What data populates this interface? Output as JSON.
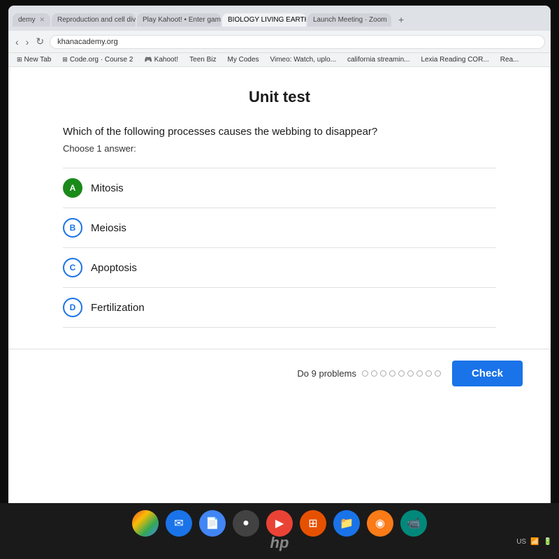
{
  "browser": {
    "address": "khanacademy.org",
    "tabs": [
      {
        "id": "t1",
        "label": "demy",
        "active": false
      },
      {
        "id": "t2",
        "label": "Reproduction and cell divi...",
        "active": false
      },
      {
        "id": "t3",
        "label": "Play Kahoot! • Enter game F",
        "active": false
      },
      {
        "id": "t4",
        "label": "BIOLOGY LIVING EARTH B T",
        "active": true
      },
      {
        "id": "t5",
        "label": "Launch Meeting · Zoom",
        "active": false
      }
    ]
  },
  "bookmarks": [
    {
      "id": "b1",
      "label": "New Tab"
    },
    {
      "id": "b2",
      "label": "Code.org · Course 2"
    },
    {
      "id": "b3",
      "label": "Kahoot!"
    },
    {
      "id": "b4",
      "label": "Teen Biz"
    },
    {
      "id": "b5",
      "label": "My Codes"
    },
    {
      "id": "b6",
      "label": "Vimeo: Watch, uplo..."
    },
    {
      "id": "b7",
      "label": "california streamin..."
    },
    {
      "id": "b8",
      "label": "Lexia Reading COR..."
    },
    {
      "id": "b9",
      "label": "Rea..."
    }
  ],
  "page": {
    "title": "Unit test",
    "question": "Which of the following processes causes the webbing to disappear?",
    "instruction": "Choose 1 answer:",
    "options": [
      {
        "id": "A",
        "label": "Mitosis",
        "selected": true
      },
      {
        "id": "B",
        "label": "Meiosis",
        "selected": false
      },
      {
        "id": "C",
        "label": "Apoptosis",
        "selected": false
      },
      {
        "id": "D",
        "label": "Fertilization",
        "selected": false
      }
    ],
    "footer": {
      "do_problems_label": "Do 9 problems",
      "check_button": "Check"
    }
  },
  "taskbar": {
    "icons": [
      {
        "id": "chrome",
        "type": "chrome",
        "symbol": ""
      },
      {
        "id": "email",
        "type": "blue",
        "symbol": "✉"
      },
      {
        "id": "docs",
        "type": "blue",
        "symbol": "📄"
      },
      {
        "id": "dark1",
        "type": "dark",
        "symbol": "🔵"
      },
      {
        "id": "youtube",
        "type": "red",
        "symbol": "▶"
      },
      {
        "id": "grid",
        "type": "grid",
        "symbol": "⊞"
      },
      {
        "id": "folder",
        "type": "folder",
        "symbol": "📁"
      },
      {
        "id": "orange",
        "type": "orange",
        "symbol": "🟠"
      },
      {
        "id": "meet",
        "type": "meet",
        "symbol": "📹"
      }
    ],
    "system": "US"
  },
  "dots_count": 9
}
